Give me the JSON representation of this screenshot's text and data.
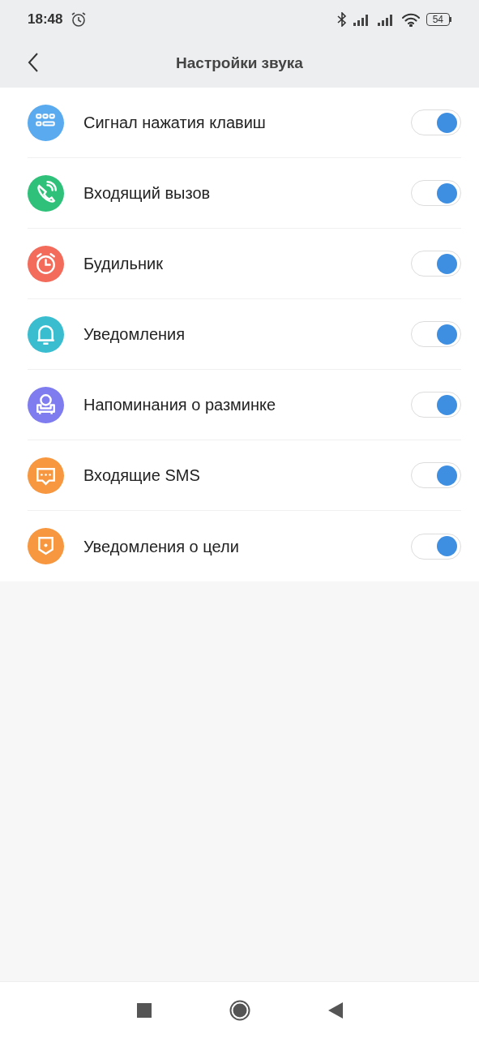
{
  "status_bar": {
    "time": "18:48",
    "battery": "54"
  },
  "header": {
    "title": "Настройки звука"
  },
  "items": [
    {
      "label": "Сигнал нажатия клавиш",
      "color": "#5aaaf0",
      "on": true
    },
    {
      "label": "Входящий вызов",
      "color": "#2fc17a",
      "on": true
    },
    {
      "label": "Будильник",
      "color": "#f26b5b",
      "on": true
    },
    {
      "label": "Уведомления",
      "color": "#3bbdd0",
      "on": true
    },
    {
      "label": "Напоминания о разминке",
      "color": "#7f7cf0",
      "on": true
    },
    {
      "label": "Входящие SMS",
      "color": "#f7973f",
      "on": true
    },
    {
      "label": "Уведомления о цели",
      "color": "#f7973f",
      "on": true
    }
  ]
}
